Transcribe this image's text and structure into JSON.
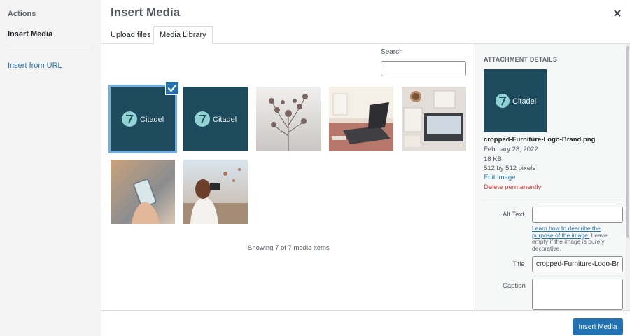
{
  "sidebar": {
    "heading": "Actions",
    "items": [
      {
        "label": "Insert Media"
      },
      {
        "label": "Insert from URL"
      }
    ]
  },
  "modal": {
    "title": "Insert Media",
    "close_icon": "close-icon"
  },
  "tabs": [
    {
      "label": "Upload files"
    },
    {
      "label": "Media Library"
    }
  ],
  "search": {
    "label": "Search",
    "value": ""
  },
  "media": {
    "logo_text": "Citadel",
    "items": [
      {
        "kind": "logo-brand",
        "selected": true
      },
      {
        "kind": "logo-brand",
        "selected": false
      },
      {
        "kind": "dried-flowers-photo",
        "selected": false
      },
      {
        "kind": "laptop-desk-photo",
        "selected": false
      },
      {
        "kind": "workspace-flatlay-photo",
        "selected": false
      },
      {
        "kind": "phone-in-hand-photo",
        "selected": false
      },
      {
        "kind": "photographer-photo",
        "selected": false
      }
    ],
    "status": "Showing 7 of 7 media items"
  },
  "details": {
    "heading": "ATTACHMENT DETAILS",
    "filename": "cropped-Furniture-Logo-Brand.png",
    "date": "February 28, 2022",
    "size": "18 KB",
    "dimensions": "512 by 512 pixels",
    "edit_label": "Edit Image",
    "delete_label": "Delete permanently",
    "alt_label": "Alt Text",
    "alt_value": "",
    "alt_help_link": "Learn how to describe the purpose of the image.",
    "alt_help_text": " Leave empty if the image is purely decorative.",
    "title_label": "Title",
    "title_value": "cropped-Furniture-Logo-Brand",
    "caption_label": "Caption",
    "caption_value": ""
  },
  "footer": {
    "insert_label": "Insert Media"
  },
  "colors": {
    "accent": "#2271b1",
    "danger": "#d63638",
    "logo_bg": "#1d4a5c",
    "logo_mark": "#8fd3d3",
    "selected_outline": "#72aee6"
  }
}
